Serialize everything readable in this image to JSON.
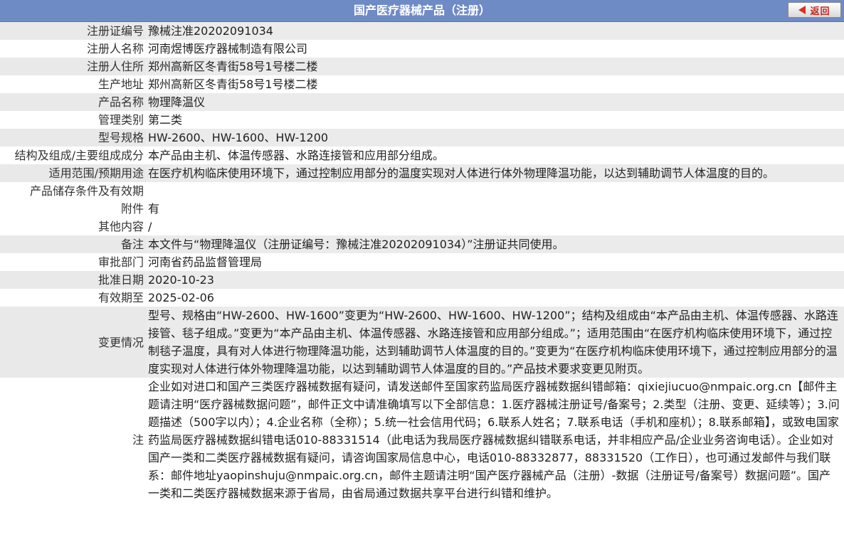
{
  "header": {
    "title": "国产医疗器械产品（注册）",
    "back_label": "返回"
  },
  "rows": [
    {
      "label": "注册证编号",
      "value": "豫械注准20202091034"
    },
    {
      "label": "注册人名称",
      "value": "河南煜博医疗器械制造有限公司"
    },
    {
      "label": "注册人住所",
      "value": "郑州高新区冬青街58号1号楼二楼"
    },
    {
      "label": "生产地址",
      "value": "郑州高新区冬青街58号1号楼二楼"
    },
    {
      "label": "产品名称",
      "value": "物理降温仪"
    },
    {
      "label": "管理类别",
      "value": "第二类"
    },
    {
      "label": "型号规格",
      "value": "HW-2600、HW-1600、HW-1200"
    },
    {
      "label": "结构及组成/主要组成成分",
      "value": "本产品由主机、体温传感器、水路连接管和应用部分组成。"
    },
    {
      "label": "适用范围/预期用途",
      "value": "在医疗机构临床使用环境下，通过控制应用部分的温度实现对人体进行体外物理降温功能，以达到辅助调节人体温度的目的。"
    },
    {
      "label": "产品储存条件及有效期",
      "value": ""
    },
    {
      "label": "附件",
      "value": "有"
    },
    {
      "label": "其他内容",
      "value": "/"
    },
    {
      "label": "备注",
      "value": "本文件与“物理降温仪（注册证编号：豫械注准20202091034）”注册证共同使用。"
    },
    {
      "label": "审批部门",
      "value": "河南省药品监督管理局"
    },
    {
      "label": "批准日期",
      "value": "2020-10-23"
    },
    {
      "label": "有效期至",
      "value": "2025-02-06"
    },
    {
      "label": "变更情况",
      "value": "型号、规格由“HW-2600、HW-1600”变更为“HW-2600、HW-1600、HW-1200”；结构及组成由“本产品由主机、体温传感器、水路连接管、毯子组成。”变更为“本产品由主机、体温传感器、水路连接管和应用部分组成。”；适用范围由“在医疗机构临床使用环境下，通过控制毯子温度，具有对人体进行物理降温功能，达到辅助调节人体温度的目的。”变更为“在医疗机构临床使用环境下，通过控制应用部分的温度实现对人体进行体外物理降温功能，以达到辅助调节人体温度的目的。”产品技术要求变更见附页。"
    },
    {
      "label": "注",
      "value": "企业如对进口和国产三类医疗器械数据有疑问，请发送邮件至国家药监局医疗器械数据纠错邮箱：qixiejiucuo@nmpaic.org.cn【邮件主题请注明“医疗器械数据问题”，邮件正文中请准确填写以下全部信息：1.医疗器械注册证号/备案号；2.类型（注册、变更、延续等）；3.问题描述（500字以内）；4.企业名称（全称）；5.统一社会信用代码；6.联系人姓名；7.联系电话（手机和座机）；8.联系邮箱】，或致电国家药监局医疗器械数据纠错电话010-88331514（此电话为我局医疗器械数据纠错联系电话，并非相应产品/企业业务咨询电话）。企业如对国产一类和二类医疗器械数据有疑问，请咨询国家局信息中心，电话010-88332877，88331520（工作日），也可通过发邮件与我们联系：邮件地址yaopinshuju@nmpaic.org.cn，邮件主题请注明“国产医疗器械产品（注册）-数据（注册证号/备案号）数据问题”。国产一类和二类医疗器械数据来源于省局，由省局通过数据共享平台进行纠错和维护。"
    }
  ]
}
